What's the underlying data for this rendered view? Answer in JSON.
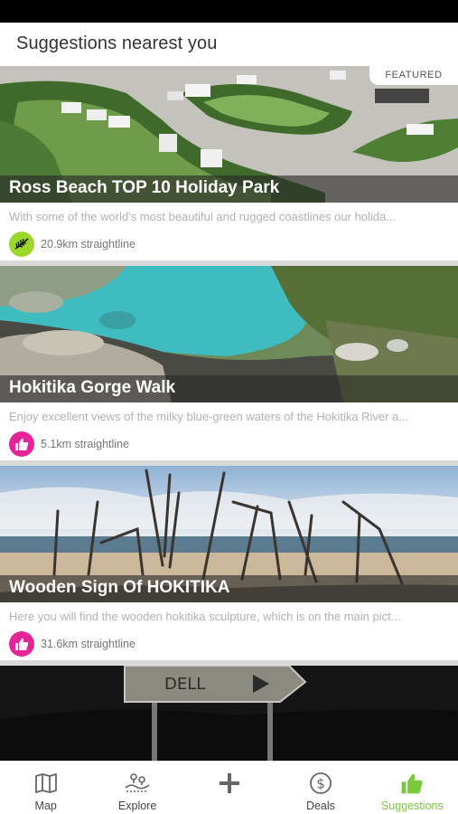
{
  "header": {
    "title": "Suggestions nearest you"
  },
  "cards": [
    {
      "title": "Ross Beach TOP 10 Holiday Park",
      "badge": "FEATURED",
      "description": "With some of the world's most beautiful and rugged coastlines our holida...",
      "distance": "20.9km straightline",
      "icon": "fern-icon",
      "icon_color": "#9bd82a"
    },
    {
      "title": "Hokitika Gorge Walk",
      "description": "Enjoy excellent views of the milky blue-green waters of the Hokitika River a...",
      "distance": "5.1km straightline",
      "icon": "thumbs-up-icon",
      "icon_color": "#e6249a"
    },
    {
      "title": "Wooden Sign Of HOKITIKA",
      "description": "Here you will find the wooden hokitika sculpture, which is on the main pict...",
      "distance": "31.6km straightline",
      "icon": "thumbs-up-icon",
      "icon_color": "#e6249a"
    },
    {
      "sign_text": "DELL"
    }
  ],
  "tabs": [
    {
      "label": "Map",
      "icon": "map-icon"
    },
    {
      "label": "Explore",
      "icon": "explore-icon"
    },
    {
      "label": "",
      "icon": "plus-icon"
    },
    {
      "label": "Deals",
      "icon": "dollar-icon"
    },
    {
      "label": "Suggestions",
      "icon": "thumbs-up-icon",
      "active": true
    }
  ],
  "colors": {
    "accent": "#7bc93a",
    "pink": "#e6249a",
    "lime": "#9bd82a"
  }
}
